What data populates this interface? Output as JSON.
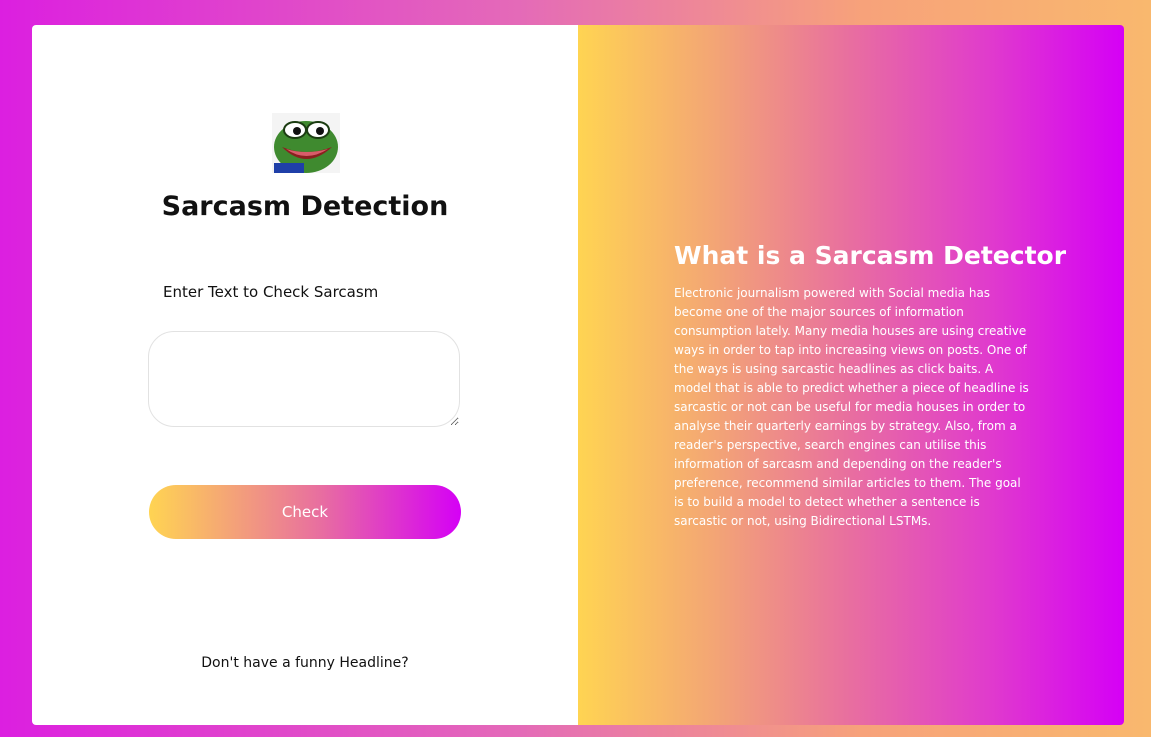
{
  "left_panel": {
    "logo_icon": "frog-meme-icon",
    "title": "Sarcasm Detection",
    "input_label": "Enter Text to Check Sarcasm",
    "input_value": "",
    "input_placeholder": "",
    "check_label": "Check",
    "footer_link": "Don't have a funny Headline?"
  },
  "right_panel": {
    "heading": "What is a Sarcasm Detector",
    "description": "Electronic journalism powered with Social media has become one of the major sources of information consumption lately. Many media houses are using creative ways in order to tap into increasing views on posts. One of the ways is using sarcastic headlines as click baits. A model that is able to predict whether a piece of headline is sarcastic or not can be useful for media houses in order to analyse their quarterly earnings by strategy. Also, from a reader's perspective, search engines can utilise this information of sarcasm and depending on the reader's preference, recommend similar articles to them. The goal is to build a model to detect whether a sentence is sarcastic or not, using Bidirectional LSTMs."
  },
  "colors": {
    "gradient_start": "#ffd452",
    "gradient_mid": "#e86ea0",
    "gradient_end": "#d500f6",
    "page_background": "#dc1fe0"
  }
}
